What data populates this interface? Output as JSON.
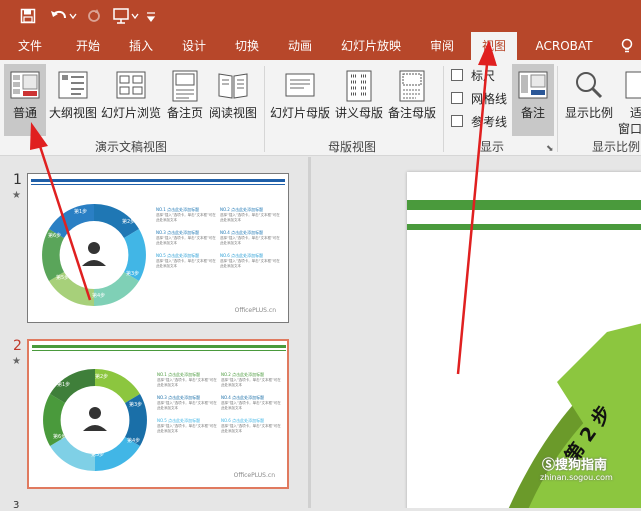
{
  "ribbon_tabs": [
    {
      "label": "文件",
      "active": false
    },
    {
      "label": "开始",
      "active": false
    },
    {
      "label": "插入",
      "active": false
    },
    {
      "label": "设计",
      "active": false
    },
    {
      "label": "切换",
      "active": false
    },
    {
      "label": "动画",
      "active": false
    },
    {
      "label": "幻灯片放映",
      "active": false
    },
    {
      "label": "审阅",
      "active": false
    },
    {
      "label": "视图",
      "active": true
    },
    {
      "label": "ACROBAT",
      "active": false
    }
  ],
  "buttons": {
    "normal": "普通",
    "outline": "大纲视图",
    "sorter": "幻灯片浏览",
    "notes_page": "备注页",
    "reading": "阅读视图",
    "slide_master": "幻灯片母版",
    "handout_master": "讲义母版",
    "notes_master": "备注母版",
    "notes": "备注",
    "zoom": "显示比例",
    "fit_frag": "适",
    "fit_frag2": "窗口"
  },
  "checkboxes": [
    "标尺",
    "网格线",
    "参考线"
  ],
  "groups": {
    "presentation_views": "演示文稿视图",
    "master_views": "母版视图",
    "show": "显示",
    "zoom": "显示比例"
  },
  "slides": [
    {
      "number": "1",
      "star": "★",
      "steps": [
        "第1步",
        "第2步",
        "第3步",
        "第4步",
        "第5步",
        "第6步"
      ],
      "items": [
        {
          "title": "NO.1 点击此处添加标题",
          "body": "选择“插入”选项卡，单击“文本框”可在此处添加文本"
        },
        {
          "title": "NO.2 点击此处添加标题",
          "body": "选择“插入”选项卡，单击“文本框”可在此处添加文本"
        },
        {
          "title": "NO.3 点击此处添加标题",
          "body": "选择“插入”选项卡，单击“文本框”可在此处添加文本"
        },
        {
          "title": "NO.4 点击此处添加标题",
          "body": "选择“插入”选项卡，单击“文本框”可在此处添加文本"
        },
        {
          "title": "NO.5 点击此处添加标题",
          "body": "选择“插入”选项卡，单击“文本框”可在此处添加文本"
        },
        {
          "title": "NO.6 点击此处添加标题",
          "body": "选择“插入”选项卡，单击“文本框”可在此处添加文本"
        }
      ],
      "footer": "OfficePLUS.cn"
    },
    {
      "number": "2",
      "star": "★",
      "steps": [
        "第1步",
        "第2步",
        "第3步",
        "第4步",
        "第5步",
        "第6步"
      ],
      "items": [
        {
          "title": "NO.1 点击此处添加标题",
          "body": "选择“插入”选项卡，单击“文本框”可在此处添加文本"
        },
        {
          "title": "NO.2 点击此处添加标题",
          "body": "选择“插入”选项卡，单击“文本框”可在此处添加文本"
        },
        {
          "title": "NO.3 点击此处添加标题",
          "body": "选择“插入”选项卡，单击“文本框”可在此处添加文本"
        },
        {
          "title": "NO.4 点击此处添加标题",
          "body": "选择“插入”选项卡，单击“文本框”可在此处添加文本"
        },
        {
          "title": "NO.5 点击此处添加标题",
          "body": "选择“插入”选项卡，单击“文本框”可在此处添加文本"
        },
        {
          "title": "NO.6 点击此处添加标题",
          "body": "选择“插入”选项卡，单击“文本框”可在此处添加文本"
        }
      ],
      "footer": "OfficePLUS.cn"
    }
  ],
  "slide3_fragment": "3",
  "editor_step_label": "第 2 步",
  "watermark": {
    "main": "搜狗指南",
    "sub": "zhinan.sogou.com"
  },
  "colors": {
    "accent": "#b7472a",
    "green": "#4a9a3c",
    "blue": "#1f5fa8",
    "annotation": "#e02020"
  }
}
